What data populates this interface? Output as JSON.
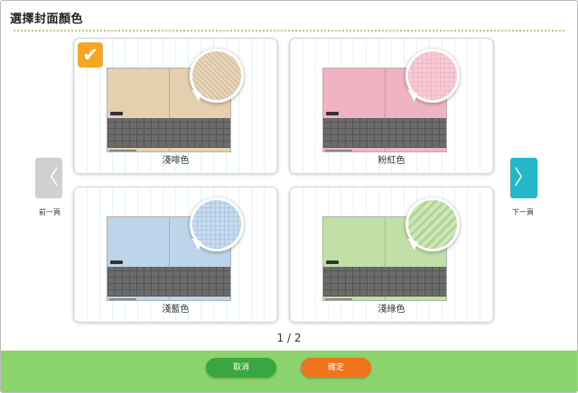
{
  "window": {
    "title": "選擇封面顏色"
  },
  "covers": [
    {
      "label": "淺啡色",
      "color": "#e4cfae",
      "swatch": "#e9d8bb",
      "selected": true
    },
    {
      "label": "粉紅色",
      "color": "#f0b3c3",
      "swatch": "#f6cbd6",
      "selected": false
    },
    {
      "label": "淺藍色",
      "color": "#bdd4ea",
      "swatch": "#c6dbee",
      "selected": false
    },
    {
      "label": "淺綠色",
      "color": "#c1e0a7",
      "swatch": "#cde7b6",
      "selected": false
    }
  ],
  "nav": {
    "prev_icon": "〈",
    "prev_label": "前一頁",
    "next_icon": "〉",
    "next_label": "下一頁"
  },
  "pager": "1 / 2",
  "buttons": {
    "cancel": "取消",
    "ok": "確定"
  },
  "colors": {
    "footer": "#8bd36c",
    "check": "#f5a623",
    "next": "#23b7c9"
  }
}
